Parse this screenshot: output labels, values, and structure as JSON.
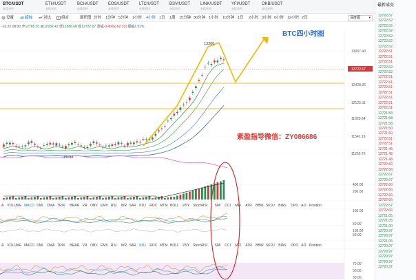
{
  "tabs": [
    {
      "symbol": "BTC/USDT",
      "sub": "永续合约",
      "active": true
    },
    {
      "symbol": "ETH/USDT",
      "sub": "永续合约",
      "active": false
    },
    {
      "symbol": "BCH/USDT",
      "sub": "永续合约",
      "active": false
    },
    {
      "symbol": "EOS/USDT",
      "sub": "永续合约",
      "active": false
    },
    {
      "symbol": "LTC/USDT",
      "sub": "永续合约",
      "active": false
    },
    {
      "symbol": "BSV/USDT",
      "sub": "永续合约",
      "active": false
    },
    {
      "symbol": "LINK/USDT",
      "sub": "永续合约",
      "active": false
    },
    {
      "symbol": "YFI/USDT",
      "sub": "永续合约",
      "active": false
    },
    {
      "symbol": "OKB/USDT",
      "sub": "永续合约",
      "active": false
    }
  ],
  "toolbar": {
    "settings": "设置",
    "kline": "蜡烛",
    "compare": "对比",
    "combine": "组合",
    "chart_type": "面积图",
    "timeframes": [
      "1分钟",
      "1分钟",
      "5分钟",
      "15分钟",
      "1小时",
      "4小时",
      "1日",
      "1周",
      "15分钟",
      "30分钟",
      "1小时",
      "10分钟",
      "1分",
      "2小时",
      "3小时",
      "6小时",
      "12小时",
      "2日"
    ],
    "timeframe_items": [
      "分时",
      "1分钟",
      "5分钟",
      "1小时",
      "4小时",
      "1日",
      "1周",
      "15分钟",
      "30分钟",
      "1小时",
      "10分钟",
      "1日",
      "2小时",
      "3小时",
      "6小时",
      "12小时",
      "2日"
    ],
    "active_timeframe": "4小时",
    "depth_select": "深度图"
  },
  "info": {
    "time": "-10.22 08:00",
    "open_label": "开",
    "open": "12785.01",
    "high_label": "高",
    "high": "12932.42",
    "low_label": "低",
    "low": "12688.68",
    "close_label": "收",
    "close": "12722.67",
    "change_label": "涨幅",
    "change": "-0.49%(-62.33)",
    "amp_label": "振幅",
    "amp": "1.91%"
  },
  "trades": {
    "title": "最新成交",
    "rows": [
      {
        "p": "12722.67",
        "d": "up"
      },
      {
        "p": "12722.52",
        "d": "up"
      },
      {
        "p": "12722.52",
        "d": "up"
      },
      {
        "p": "12722.52",
        "d": "up"
      },
      {
        "p": "12722.52",
        "d": "up"
      },
      {
        "p": "12722.52",
        "d": "up"
      },
      {
        "p": "12722.52",
        "d": "up"
      },
      {
        "p": "12722.51",
        "d": "dn"
      },
      {
        "p": "12722.51",
        "d": "dn"
      },
      {
        "p": "12722.51",
        "d": "dn"
      },
      {
        "p": "12722.52",
        "d": "up"
      },
      {
        "p": "12722.52",
        "d": "up"
      },
      {
        "p": "12722.51",
        "d": "dn"
      },
      {
        "p": "12722.51",
        "d": "dn"
      },
      {
        "p": "12722.51",
        "d": "dn"
      },
      {
        "p": "12722.51",
        "d": "dn"
      },
      {
        "p": "12722.51",
        "d": "dn"
      },
      {
        "p": "12722.51",
        "d": "dn"
      },
      {
        "p": "12722.51",
        "d": "dn"
      },
      {
        "p": "12721.58",
        "d": "up"
      },
      {
        "p": "12721.58",
        "d": "up"
      },
      {
        "p": "12721.58",
        "d": "up"
      },
      {
        "p": "12721.50",
        "d": "dn"
      },
      {
        "p": "12721.50",
        "d": "dn"
      },
      {
        "p": "12722.51",
        "d": "dn"
      },
      {
        "p": "12722.51",
        "d": "dn"
      },
      {
        "p": "12721.46",
        "d": "dn"
      },
      {
        "p": "12721.48",
        "d": "dn"
      },
      {
        "p": "12721.48",
        "d": "dn"
      },
      {
        "p": "12722.66",
        "d": "dn"
      },
      {
        "p": "12722.66",
        "d": "dn"
      },
      {
        "p": "12722.67",
        "d": "up"
      },
      {
        "p": "12722.67",
        "d": "up"
      },
      {
        "p": "12722.66",
        "d": "dn"
      },
      {
        "p": "12722.66",
        "d": "dn"
      },
      {
        "p": "12722.66",
        "d": "dn"
      },
      {
        "p": "12722.66",
        "d": "dn"
      },
      {
        "p": "12722.67",
        "d": "up"
      },
      {
        "p": "12722.66",
        "d": "dn"
      },
      {
        "p": "12721.05",
        "d": "up"
      },
      {
        "p": "12721.05",
        "d": "up"
      },
      {
        "p": "12721.00",
        "d": "up"
      },
      {
        "p": "12720.97",
        "d": "up"
      },
      {
        "p": "12720.97",
        "d": "up"
      },
      {
        "p": "12721.05",
        "d": "up"
      },
      {
        "p": "12720.97",
        "d": "up"
      },
      {
        "p": "12720.97",
        "d": "up"
      },
      {
        "p": "12720.97",
        "d": "up"
      },
      {
        "p": "12720.97",
        "d": "up"
      },
      {
        "p": "12720.97",
        "d": "up"
      }
    ]
  },
  "chart": {
    "price_axis": [
      "13057.40",
      "12722.67",
      "12428.36",
      "12125.31",
      "11829.64",
      "11541.19",
      "11259.76"
    ],
    "current_price": "12722.67",
    "high_label": "13200",
    "low_label": "11188",
    "annotation_title": "BTC四小时图",
    "annotation_wechat": "紫盈指导微信：ZY086686",
    "vol_axis": [
      "400.00",
      "200.00"
    ],
    "ind1_axis": [
      "100.00",
      "50.00"
    ],
    "ind2_axis": [
      "100.00",
      "50.00"
    ],
    "ind3_axis": [
      "70.00",
      "50.00",
      "30.00"
    ],
    "ind_tabs_1": [
      "A",
      "VOLUME",
      "MACD",
      "DMI",
      "DMA",
      "TRIX",
      "BRAR",
      "VR",
      "OBV",
      "EMV",
      "RSI",
      "WR",
      "SAR",
      "KDJ",
      "ROC",
      "MTM",
      "BOLL",
      "PSY",
      "StochRSI",
      "SMI",
      "CCI",
      "MFI",
      "ATR",
      "BBW",
      "SKDJ",
      "BIAS",
      "DPO",
      "AO",
      "Position"
    ],
    "ind_tabs_2": [
      "A",
      "VOLUME",
      "MACD",
      "DMI",
      "DMA",
      "TRIX",
      "BRAR",
      "VR",
      "OBV",
      "EMV",
      "RSI",
      "WR",
      "SAR",
      "KDJ",
      "ROC",
      "MTM",
      "BOLL",
      "PSY",
      "StochRSI",
      "SMI",
      "CCI",
      "MFI",
      "ATR",
      "BBW",
      "SKDJ",
      "BIAS",
      "DPO",
      "AO",
      "Position"
    ],
    "active_tab_1": "MACD",
    "active_tab_2": "KDJ",
    "colors": {
      "up": "#2a8f4e",
      "down": "#d33b3b",
      "yellow": "#f0c020",
      "orange": "#f5b800",
      "annotation_blue": "#2b6fe6",
      "annotation_red": "#e53935",
      "magenta": "#c040c0",
      "ma1": "#2a8f4e",
      "ma2": "#4caf50",
      "ma3": "#4a90e2",
      "ma4": "#1e4fa8",
      "ma5": "#d36bd3",
      "ind_bg": "#f0e4f5"
    }
  }
}
